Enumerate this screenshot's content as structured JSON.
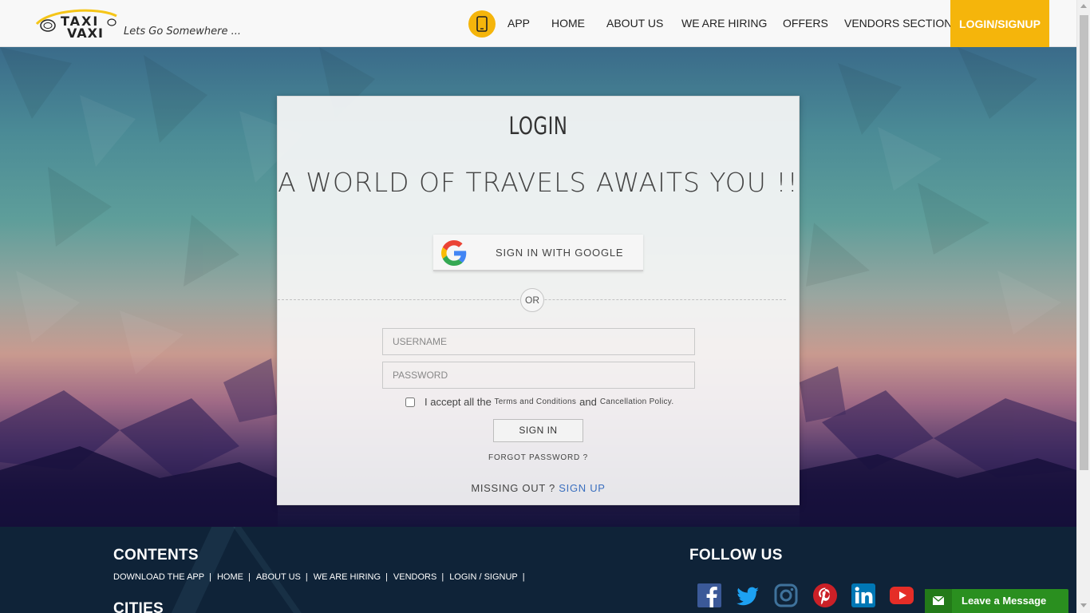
{
  "brand": {
    "logo_text_top": "TAXI",
    "logo_text_bottom": "VAXI",
    "tagline": "Lets Go Somewhere ..."
  },
  "nav": {
    "app_icon": "mobile-phone-icon",
    "items": [
      "APP",
      "HOME",
      "ABOUT US",
      "WE ARE HIRING",
      "OFFERS",
      "VENDORS SECTION"
    ],
    "login": "LOGIN/SIGNUP"
  },
  "login": {
    "title": "LOGIN",
    "subtitle": "A WORLD OF TRAVELS AWAITS YOU !!",
    "google_label": "SIGN IN WITH GOOGLE",
    "or": "OR",
    "username_placeholder": "USERNAME",
    "password_placeholder": "PASSWORD",
    "terms_prefix": "I accept all the",
    "terms_link": "Terms and Conditions",
    "terms_and": "and",
    "policy_link": "Cancellation Policy.",
    "signin": "SIGN IN",
    "forgot": "FORGOT PASSWORD ?",
    "missing": "MISSING OUT ?",
    "signup": "SIGN UP"
  },
  "footer": {
    "contents_heading": "CONTENTS",
    "links": [
      "DOWNLOAD THE APP",
      "HOME",
      "ABOUT US",
      "WE ARE HIRING",
      "VENDORS",
      "LOGIN / SIGNUP"
    ],
    "separator": "|",
    "cities_heading": "CITIES",
    "follow_heading": "FOLLOW US",
    "social": [
      "facebook-icon",
      "twitter-icon",
      "instagram-icon",
      "pinterest-icon",
      "linkedin-icon",
      "youtube-icon"
    ]
  },
  "chat": {
    "label": "Leave a Message",
    "icon": "envelope-icon"
  },
  "colors": {
    "accent": "#f5b50b",
    "link": "#3b6fbf",
    "footer_bg": "#0f2338",
    "chat_green": "#2a8f1f"
  }
}
